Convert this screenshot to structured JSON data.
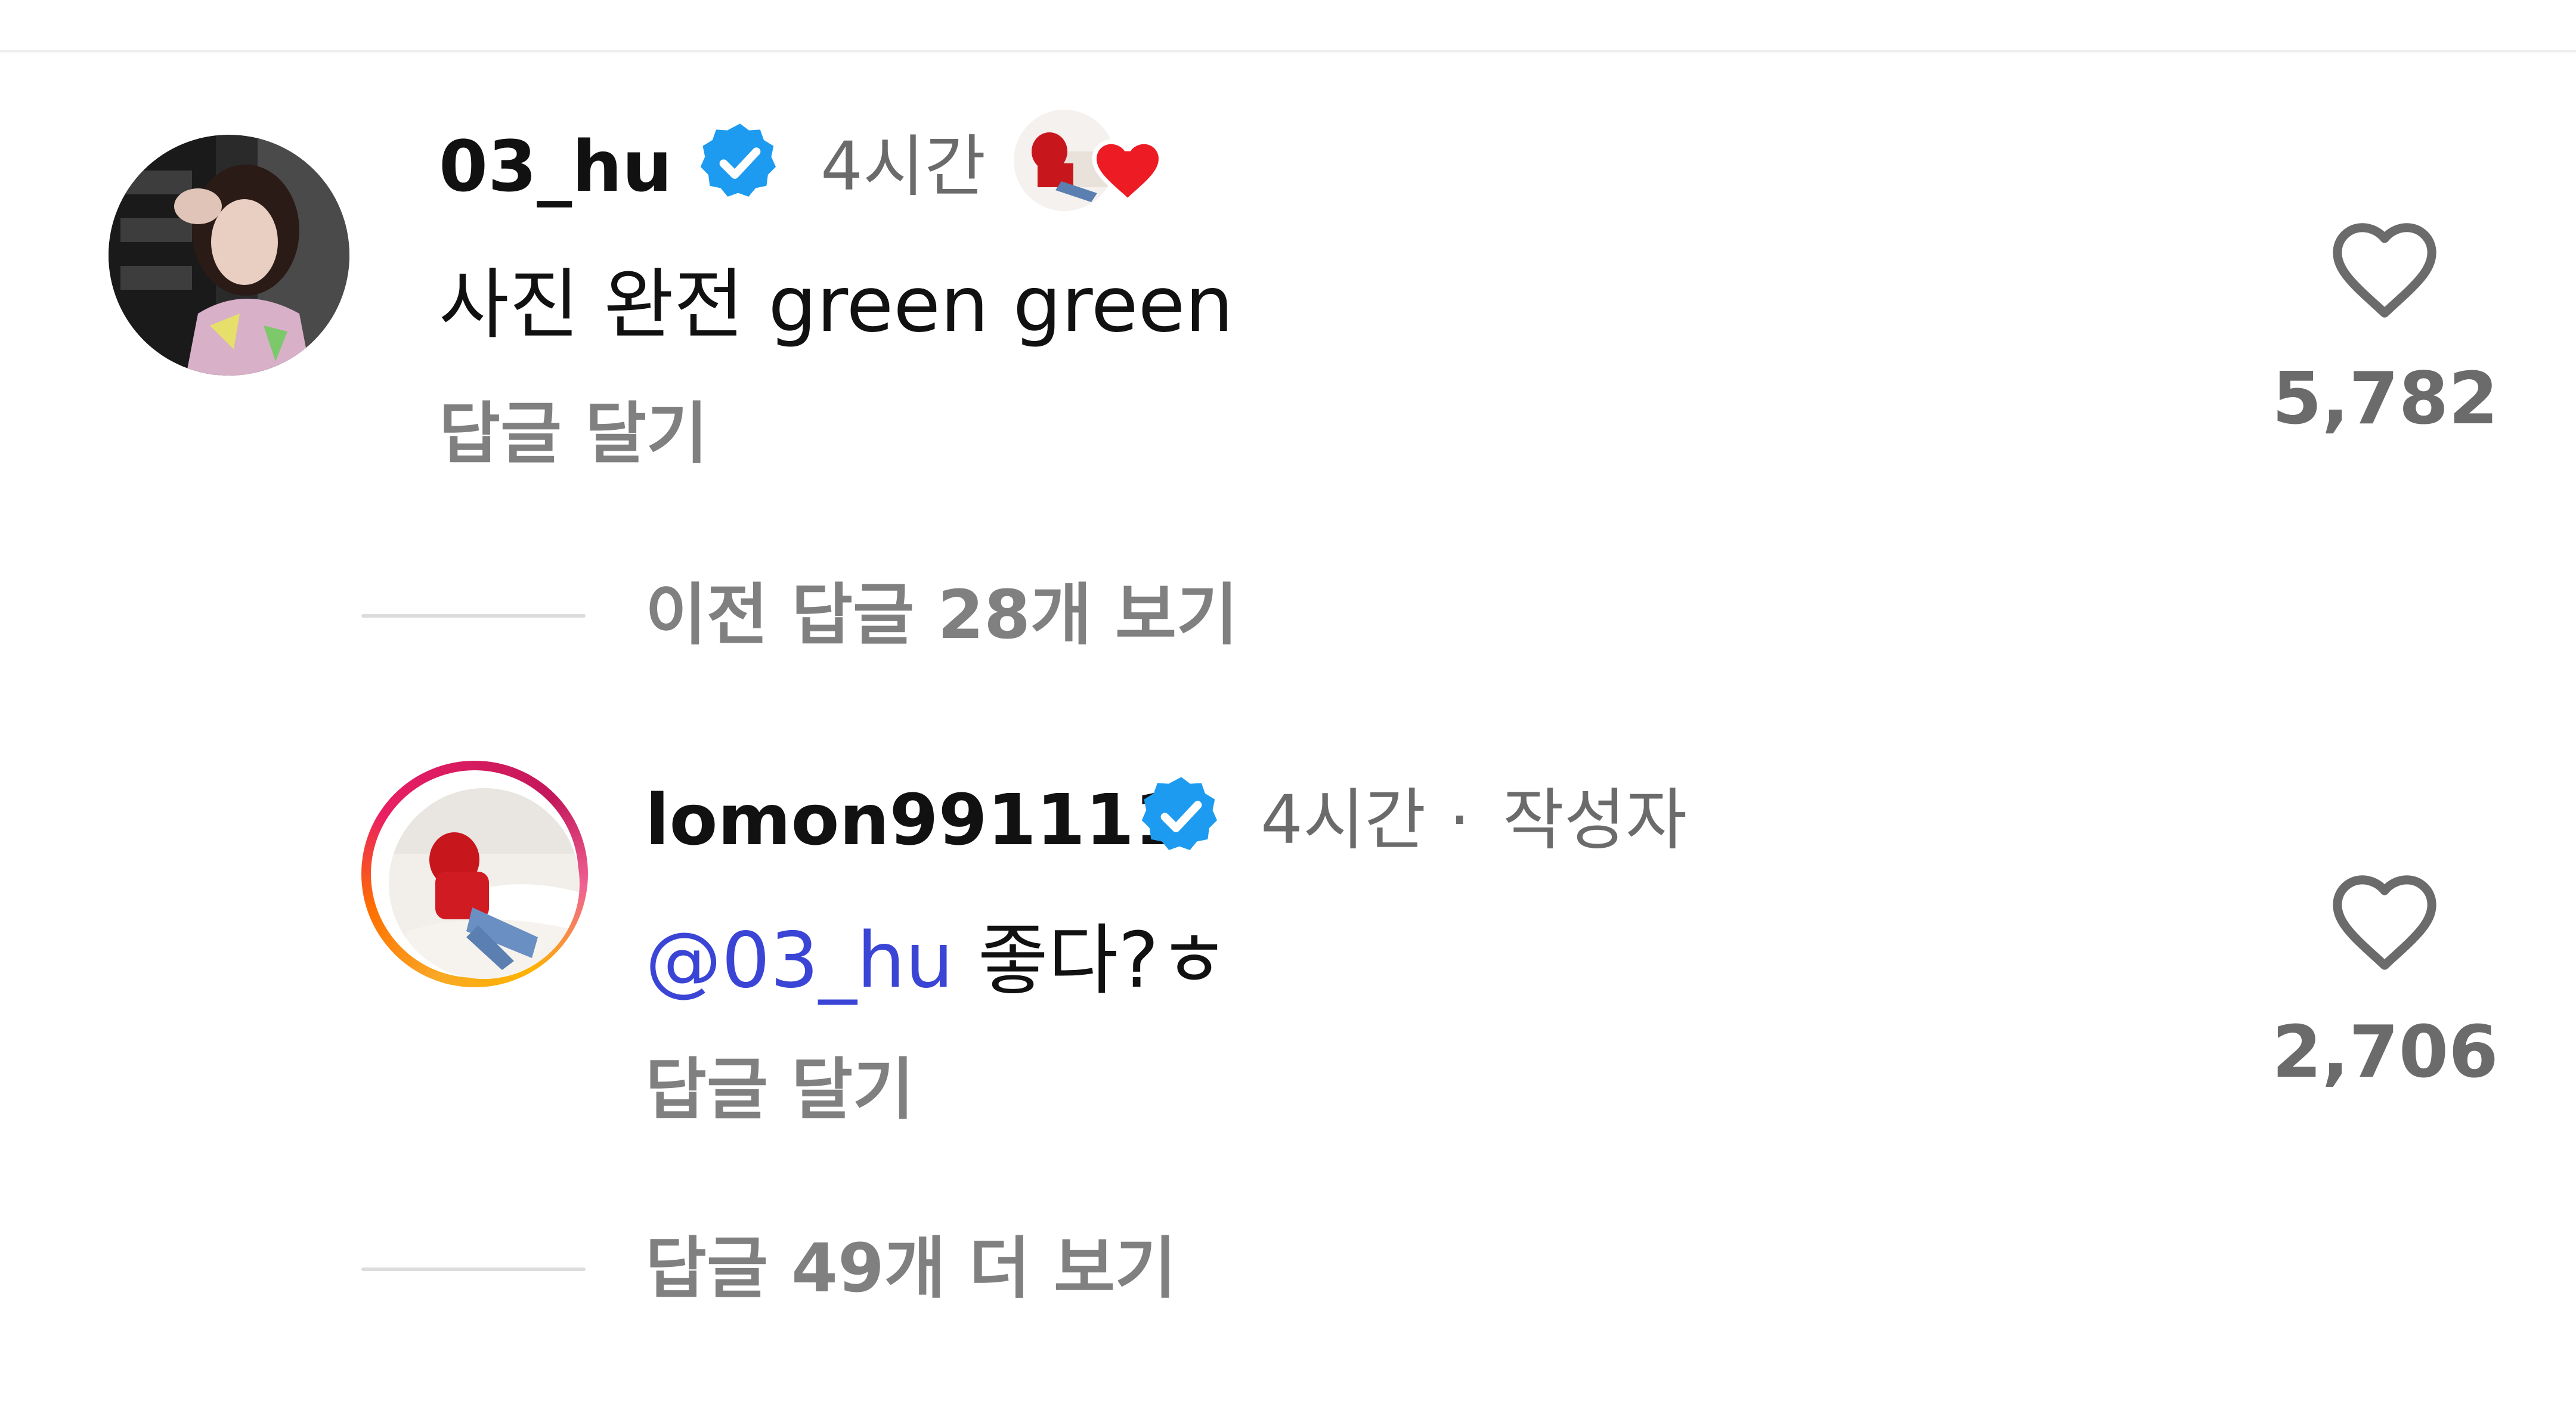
{
  "comment": {
    "username": "03_hu",
    "time": "4시간",
    "text": "사진 완전 green green",
    "reply_label": "답글 달기",
    "likes": "5,782",
    "liked_by_author": true
  },
  "view_previous_replies": "이전 답글 28개 보기",
  "reply": {
    "username": "lomon991111",
    "time": "4시간",
    "separator": "·",
    "author_tag": "작성자",
    "mention": "@03_hu",
    "text": "좋다?ㅎ",
    "reply_label": "답글 달기",
    "likes": "2,706"
  },
  "view_more_replies": "답글 49개 더 보기",
  "colors": {
    "verified": "#1d9bf0",
    "mention": "#3a45d6",
    "like_heart": "#ed1c24",
    "muted_text": "#6b6b6b"
  },
  "icons": {
    "verified": "verified-badge-icon",
    "like": "heart-outline-icon",
    "author_like": "heart-filled-icon"
  }
}
